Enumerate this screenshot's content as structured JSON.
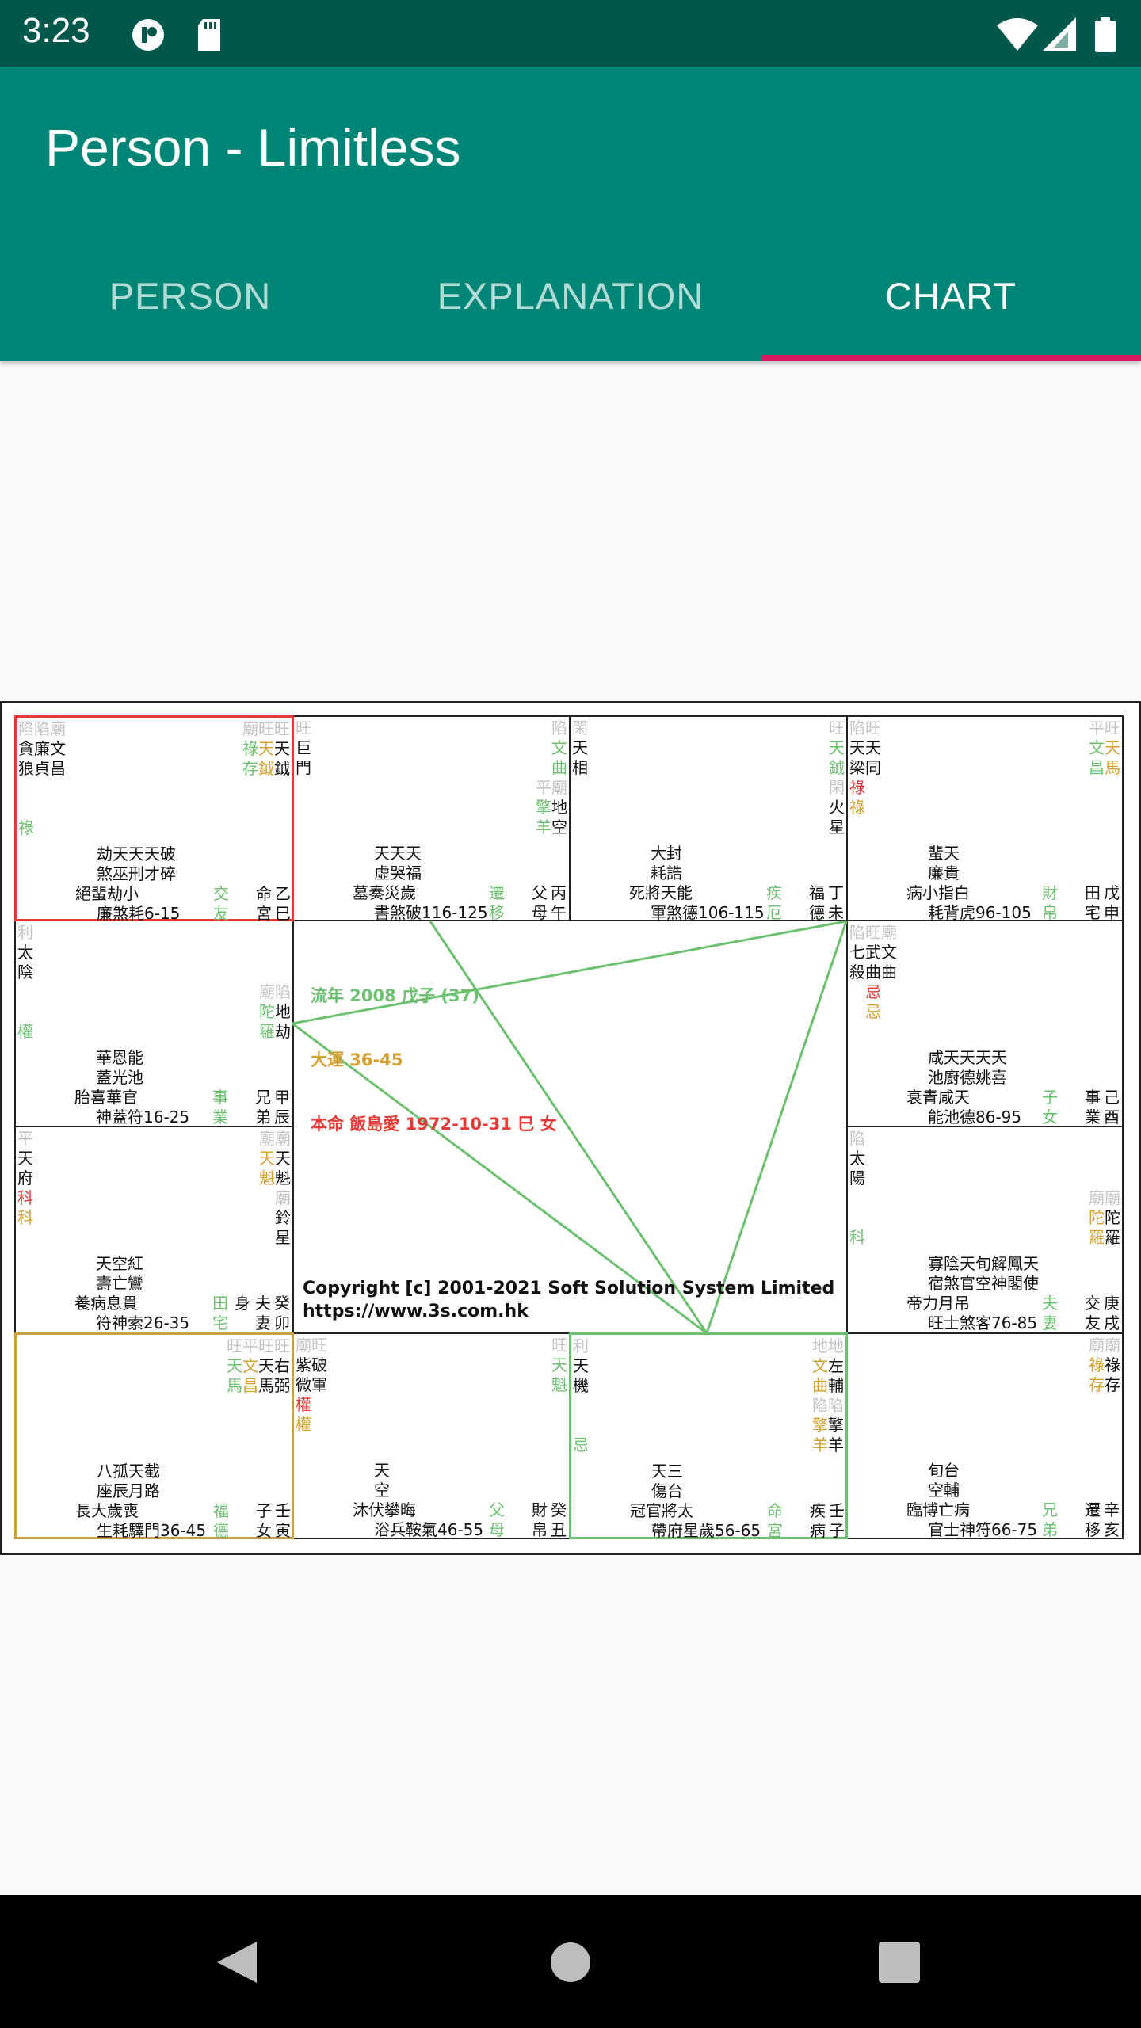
{
  "status_bar": {
    "time": "3:23",
    "icons": [
      "app-notification-icon",
      "sd-card-icon",
      "wifi-icon",
      "signal-icon",
      "battery-icon"
    ]
  },
  "app_bar": {
    "title": "Person - Limitless"
  },
  "tabs": [
    {
      "label": "PERSON",
      "active": false
    },
    {
      "label": "EXPLANATION",
      "active": false
    },
    {
      "label": "CHART",
      "active": true
    }
  ],
  "colors": {
    "primary": "#008577",
    "primary_dark": "#00574b",
    "accent": "#d81b60",
    "chart_green": "#6cc070",
    "chart_gold": "#d4a030",
    "chart_red": "#e53935",
    "chart_gray": "#c4c4c4"
  },
  "chart": {
    "center": {
      "flow_year": "流年 2008 戊子 (37)",
      "decade": "大運 36-45",
      "natal": "本命 飯島愛 1972-10-31 巳 女"
    },
    "copyright": "Copyright [c] 2001-2021 Soft Solution System Limited",
    "url": "https://www.3s.com.hk",
    "cells": [
      {
        "branch": "巳",
        "highlight": "red",
        "tl": [
          [
            [
              "陷陷廟",
              "g"
            ]
          ],
          [
            [
              "貪廉文",
              "k"
            ]
          ],
          [
            [
              "狼貞昌",
              "k"
            ]
          ],
          [],
          [],
          [
            [
              "祿",
              "G"
            ]
          ]
        ],
        "tr": [
          [
            [
              "廟旺旺",
              "g"
            ]
          ],
          [
            [
              "祿",
              "G"
            ],
            [
              "天",
              "o"
            ],
            [
              "天",
              "k"
            ]
          ],
          [
            [
              "存",
              "G"
            ],
            [
              "鉞",
              "o"
            ],
            [
              "鉞",
              "k"
            ]
          ]
        ],
        "minor": [
          "劫天天天破",
          "煞巫刑才碎",
          "絕蜚劫小",
          "廉煞耗6-15"
        ],
        "green": "交友",
        "palace": "命宮",
        "stem": "乙巳"
      },
      {
        "branch": "午",
        "tl": [
          [
            [
              "旺",
              "g"
            ]
          ],
          [
            [
              "巨",
              "k"
            ]
          ],
          [
            [
              "門",
              "k"
            ]
          ]
        ],
        "tr": [
          [
            [
              "陷",
              "g"
            ]
          ],
          [
            [
              "文",
              "G"
            ]
          ],
          [
            [
              "曲",
              "G"
            ]
          ],
          [
            [
              "平廟",
              "g"
            ]
          ],
          [
            [
              "擎",
              "G"
            ],
            [
              "地",
              "k"
            ]
          ],
          [
            [
              "羊",
              "G"
            ],
            [
              "空",
              "k"
            ]
          ]
        ],
        "minor": [
          "天天天",
          "虛哭福",
          "墓奏災歲",
          "書煞破116-125"
        ],
        "green": "遷移",
        "palace": "父母",
        "stem": "丙午"
      },
      {
        "branch": "未",
        "tl": [
          [
            [
              "閑",
              "g"
            ]
          ],
          [
            [
              "天",
              "k"
            ]
          ],
          [
            [
              "相",
              "k"
            ]
          ]
        ],
        "tr": [
          [
            [
              "旺",
              "g"
            ]
          ],
          [
            [
              "天",
              "G"
            ]
          ],
          [
            [
              "鉞",
              "G"
            ]
          ],
          [
            [
              "閑",
              "g"
            ]
          ],
          [
            [
              "火",
              "k"
            ]
          ],
          [
            [
              "星",
              "k"
            ]
          ]
        ],
        "minor": [
          "大封",
          "耗誥",
          "死將天能",
          "軍煞德106-115"
        ],
        "green": "疾厄",
        "palace": "福德",
        "stem": "丁未"
      },
      {
        "branch": "申",
        "tl": [
          [
            [
              "陷旺",
              "g"
            ]
          ],
          [
            [
              "天天",
              "k"
            ]
          ],
          [
            [
              "梁同",
              "k"
            ]
          ],
          [
            [
              "祿",
              "r"
            ]
          ],
          [
            [
              "祿",
              "o"
            ]
          ]
        ],
        "tr": [
          [
            [
              "平旺",
              "g"
            ]
          ],
          [
            [
              "文",
              "G"
            ],
            [
              "天",
              "o"
            ]
          ],
          [
            [
              "昌",
              "G"
            ],
            [
              "馬",
              "o"
            ]
          ]
        ],
        "minor": [
          "蜚天",
          "廉貴",
          "病小指白",
          "耗背虎96-105"
        ],
        "green": "財帛",
        "palace": "田宅",
        "stem": "戊申"
      },
      {
        "branch": "辰",
        "tl": [
          [
            [
              "利",
              "g"
            ]
          ],
          [
            [
              "太",
              "k"
            ]
          ],
          [
            [
              "陰",
              "k"
            ]
          ],
          [],
          [],
          [
            [
              "權",
              "G"
            ]
          ]
        ],
        "tr": [
          [],
          [],
          [],
          [
            [
              "廟陷",
              "g"
            ]
          ],
          [
            [
              "陀",
              "G"
            ],
            [
              "地",
              "k"
            ]
          ],
          [
            [
              "羅",
              "G"
            ],
            [
              "劫",
              "k"
            ]
          ]
        ],
        "minor": [
          "華恩能",
          "蓋光池",
          "胎喜華官",
          "神蓋符16-25"
        ],
        "green": "事業",
        "palace": "兄弟",
        "stem": "甲辰"
      },
      {
        "branch": "酉",
        "tl": [
          [
            [
              "陷旺廟",
              "g"
            ]
          ],
          [
            [
              "七武文",
              "k"
            ]
          ],
          [
            [
              "殺曲曲",
              "k"
            ]
          ],
          [
            [
              "　",
              ""
            ],
            [
              "忌",
              "r"
            ]
          ],
          [
            [
              "　",
              ""
            ],
            [
              "忌",
              "o"
            ]
          ]
        ],
        "tr": [],
        "minor": [
          "咸天天天天",
          "池廚德姚喜",
          "衰青咸天",
          "能池德86-95"
        ],
        "green": "子女",
        "palace": "事業",
        "stem": "己酉"
      },
      {
        "branch": "卯",
        "tl": [
          [
            [
              "平",
              "g"
            ]
          ],
          [
            [
              "天",
              "k"
            ]
          ],
          [
            [
              "府",
              "k"
            ]
          ],
          [
            [
              "科",
              "r"
            ]
          ],
          [
            [
              "科",
              "o"
            ]
          ]
        ],
        "tr": [
          [
            [
              "廟廟",
              "g"
            ]
          ],
          [
            [
              "天",
              "o"
            ],
            [
              "天",
              "k"
            ]
          ],
          [
            [
              "魁",
              "o"
            ],
            [
              "魁",
              "k"
            ]
          ],
          [
            [
              "廟",
              "g"
            ]
          ],
          [
            [
              "鈴",
              "k"
            ]
          ],
          [
            [
              "星",
              "k"
            ]
          ]
        ],
        "minor": [
          "天空紅",
          "壽亡鸞",
          "養病息貫",
          "符神索26-35"
        ],
        "green": "田宅",
        "body": "身",
        "palace": "夫妻",
        "stem": "癸卯"
      },
      {
        "branch": "戌",
        "tl": [
          [
            [
              "陷",
              "g"
            ]
          ],
          [
            [
              "太",
              "k"
            ]
          ],
          [
            [
              "陽",
              "k"
            ]
          ],
          [],
          [],
          [
            [
              "科",
              "G"
            ]
          ]
        ],
        "tr": [
          [],
          [],
          [],
          [
            [
              "廟廟",
              "g"
            ]
          ],
          [
            [
              "陀",
              "o"
            ],
            [
              "陀",
              "k"
            ]
          ],
          [
            [
              "羅",
              "o"
            ],
            [
              "羅",
              "k"
            ]
          ]
        ],
        "minor": [
          "寡陰天旬解鳳天",
          "宿煞官空神閣使",
          "帝力月吊",
          "旺士煞客76-85"
        ],
        "green": "夫妻",
        "palace": "交友",
        "stem": "庚戌"
      },
      {
        "branch": "寅",
        "highlight": "gold",
        "tl": [],
        "tr": [
          [
            [
              "旺平旺旺",
              "g"
            ]
          ],
          [
            [
              "天",
              "G"
            ],
            [
              "文",
              "o"
            ],
            [
              "天右",
              "k"
            ]
          ],
          [
            [
              "馬",
              "G"
            ],
            [
              "昌",
              "o"
            ],
            [
              "馬弼",
              "k"
            ]
          ]
        ],
        "minor": [
          "八孤天截",
          "座辰月路",
          "長大歲喪",
          "生耗驛門36-45"
        ],
        "green": "福德",
        "palace": "子女",
        "stem": "壬寅"
      },
      {
        "branch": "丑",
        "tl": [
          [
            [
              "廟旺",
              "g"
            ]
          ],
          [
            [
              "紫破",
              "k"
            ]
          ],
          [
            [
              "微軍",
              "k"
            ]
          ],
          [
            [
              "權",
              "r"
            ]
          ],
          [
            [
              "權",
              "o"
            ]
          ]
        ],
        "tr": [
          [
            [
              "旺",
              "g"
            ]
          ],
          [
            [
              "天",
              "G"
            ]
          ],
          [
            [
              "魁",
              "G"
            ]
          ]
        ],
        "minor": [
          "天",
          "空",
          "沐伏攀晦",
          "浴兵鞍氣46-55"
        ],
        "green": "父母",
        "palace": "財帛",
        "stem": "癸丑"
      },
      {
        "branch": "子",
        "highlight": "green",
        "tl": [
          [
            [
              "利",
              "g"
            ]
          ],
          [
            [
              "天",
              "k"
            ]
          ],
          [
            [
              "機",
              "k"
            ]
          ],
          [],
          [],
          [
            [
              "忌",
              "G"
            ]
          ]
        ],
        "tr": [
          [
            [
              "地地",
              "g"
            ]
          ],
          [
            [
              "文",
              "o"
            ],
            [
              "左",
              "k"
            ]
          ],
          [
            [
              "曲",
              "o"
            ],
            [
              "輔",
              "k"
            ]
          ],
          [
            [
              "陷陷",
              "g"
            ]
          ],
          [
            [
              "擎",
              "o"
            ],
            [
              "擎",
              "k"
            ]
          ],
          [
            [
              "羊",
              "o"
            ],
            [
              "羊",
              "k"
            ]
          ]
        ],
        "minor": [
          "天三",
          "傷台",
          "冠官將太",
          "帶府星歲56-65"
        ],
        "green": "命宮",
        "palace": "疾病",
        "stem": "壬子"
      },
      {
        "branch": "亥",
        "tl": [],
        "tr": [
          [
            [
              "廟廟",
              "g"
            ]
          ],
          [
            [
              "祿",
              "o"
            ],
            [
              "祿",
              "k"
            ]
          ],
          [
            [
              "存",
              "o"
            ],
            [
              "存",
              "k"
            ]
          ]
        ],
        "minor": [
          "旬台",
          "空輔",
          "臨博亡病",
          "官士神符66-75"
        ],
        "green": "兄弟",
        "palace": "遷移",
        "stem": "辛亥"
      }
    ]
  },
  "nav_bar": {
    "icons": [
      "back-icon",
      "home-icon",
      "recents-icon"
    ]
  }
}
